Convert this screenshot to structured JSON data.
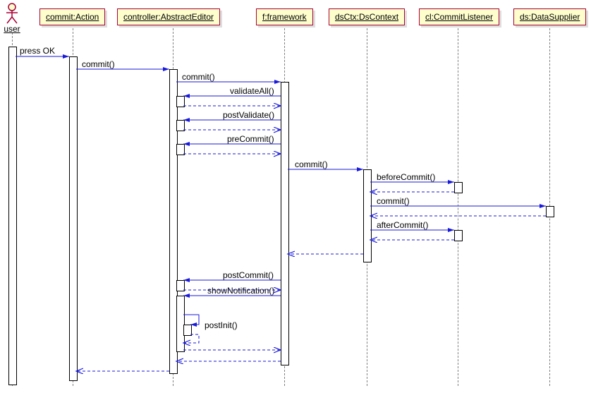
{
  "actor": {
    "name": "user"
  },
  "participants": {
    "commit": "commit:Action",
    "controller": "controller:AbstractEditor",
    "framework": "f:framework",
    "dsctx": "dsCtx:DsContext",
    "cl": "cl:CommitListener",
    "ds": "ds:DataSupplier"
  },
  "messages": {
    "pressOk": "press OK",
    "commit1": "commit()",
    "commit2": "commit()",
    "validateAll": "validateAll()",
    "postValidate": "postValidate()",
    "preCommit": "preCommit()",
    "commit3": "commit()",
    "beforeCommit": "beforeCommit()",
    "commit4": "commit()",
    "afterCommit": "afterCommit()",
    "postCommit": "postCommit()",
    "showNotification": "showNotification()",
    "postInit": "postInit()"
  }
}
